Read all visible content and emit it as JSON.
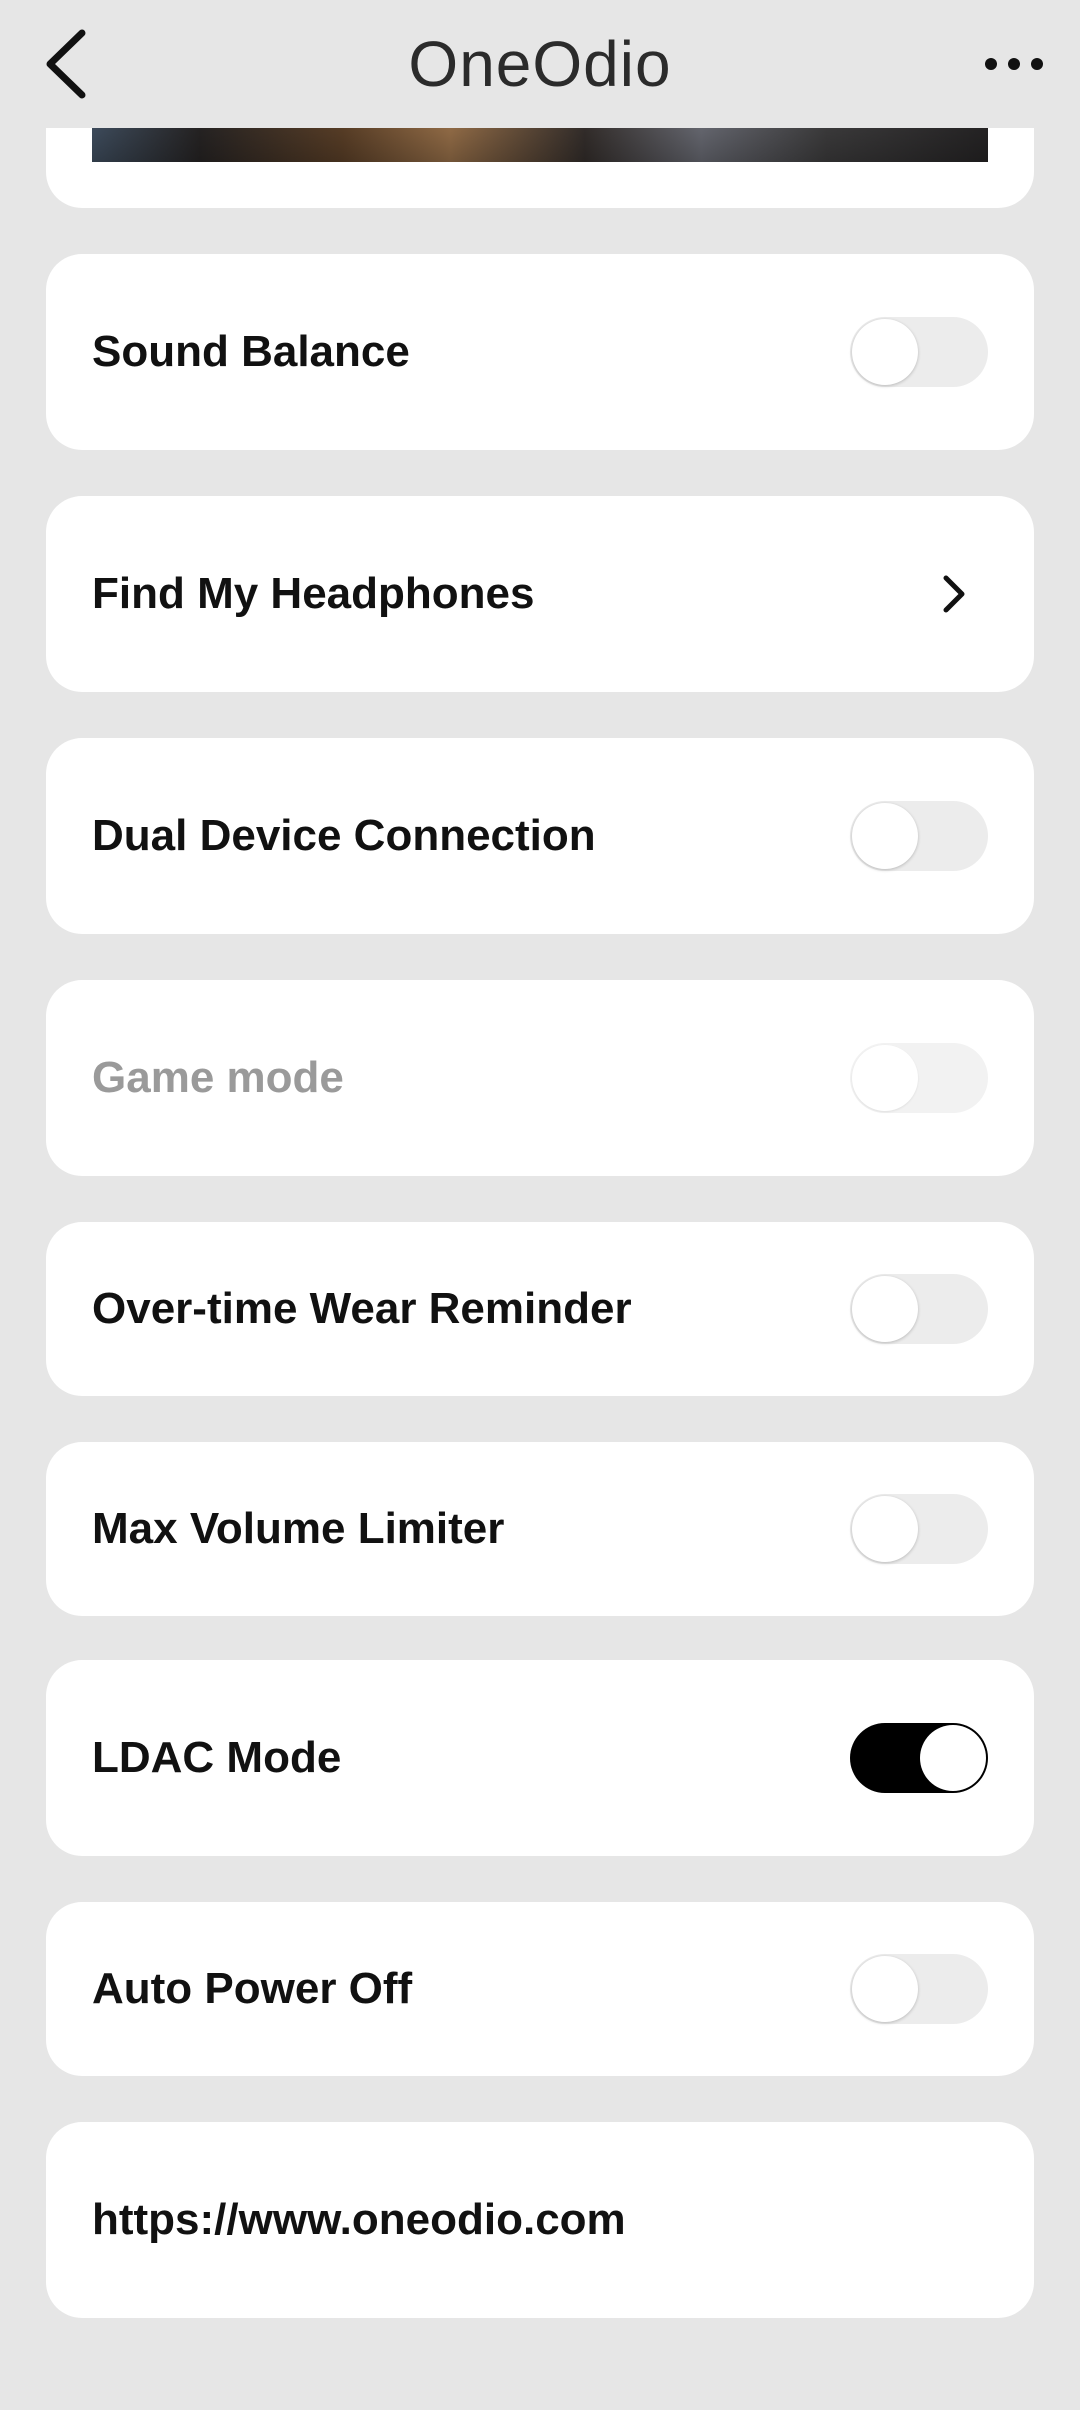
{
  "header": {
    "title": "OneOdio",
    "back_icon": "chevron-left-icon",
    "more_icon": "more-horizontal-icon"
  },
  "settings": [
    {
      "label": "Sound Balance",
      "control": "toggle",
      "state": "off"
    },
    {
      "label": "Find My Headphones",
      "control": "chevron",
      "state": ""
    },
    {
      "label": "Dual Device Connection",
      "control": "toggle",
      "state": "off"
    },
    {
      "label": "Game mode",
      "control": "toggle",
      "state": "disabled"
    },
    {
      "label": "Over-time Wear Reminder",
      "control": "toggle",
      "state": "off"
    },
    {
      "label": "Max Volume Limiter",
      "control": "toggle",
      "state": "off"
    },
    {
      "label": "LDAC Mode",
      "control": "toggle",
      "state": "on"
    },
    {
      "label": "Auto Power Off",
      "control": "toggle",
      "state": "off"
    }
  ],
  "footer_link": "https://www.oneodio.com",
  "colors": {
    "background": "#e6e6e6",
    "card": "#ffffff",
    "toggle_on": "#000000",
    "toggle_off": "#ececec",
    "disabled_text": "#9a9a9a"
  }
}
